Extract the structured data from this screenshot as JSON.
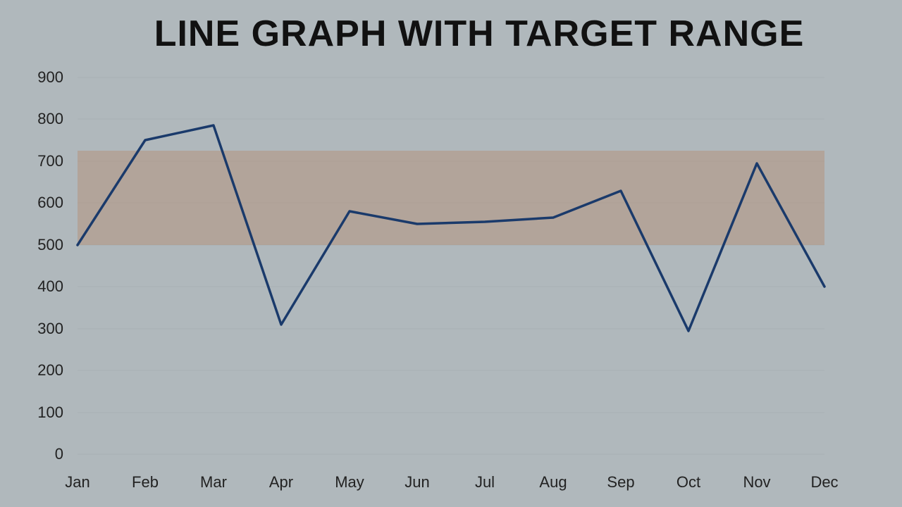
{
  "title": "LINE GRAPH WITH TARGET RANGE",
  "chart": {
    "yAxis": {
      "min": 0,
      "max": 900,
      "step": 100,
      "labels": [
        "900",
        "800",
        "700",
        "600",
        "500",
        "400",
        "300",
        "200",
        "100",
        "0"
      ]
    },
    "xAxis": {
      "labels": [
        "Jan",
        "Feb",
        "Mar",
        "Apr",
        "May",
        "Jun",
        "Jul",
        "Aug",
        "Sep",
        "Oct",
        "Nov",
        "Dec"
      ]
    },
    "targetRange": {
      "lower": 500,
      "upper": 725
    },
    "dataPoints": [
      {
        "month": "Jan",
        "value": 500
      },
      {
        "month": "Feb",
        "value": 750
      },
      {
        "month": "Mar",
        "value": 785
      },
      {
        "month": "Apr",
        "value": 310
      },
      {
        "month": "May",
        "value": 580
      },
      {
        "month": "Jun",
        "value": 550
      },
      {
        "month": "Jul",
        "value": 555
      },
      {
        "month": "Aug",
        "value": 565
      },
      {
        "month": "Sep",
        "value": 630
      },
      {
        "month": "Oct",
        "value": 295
      },
      {
        "month": "Nov",
        "value": 695
      },
      {
        "month": "Dec",
        "value": 400
      }
    ],
    "colors": {
      "background": "#b0b8bc",
      "gridLine": "#a8b0b4",
      "targetRange": "rgba(180,150,130,0.55)",
      "line": "#1a3a6b",
      "axisLabel": "#222"
    }
  }
}
